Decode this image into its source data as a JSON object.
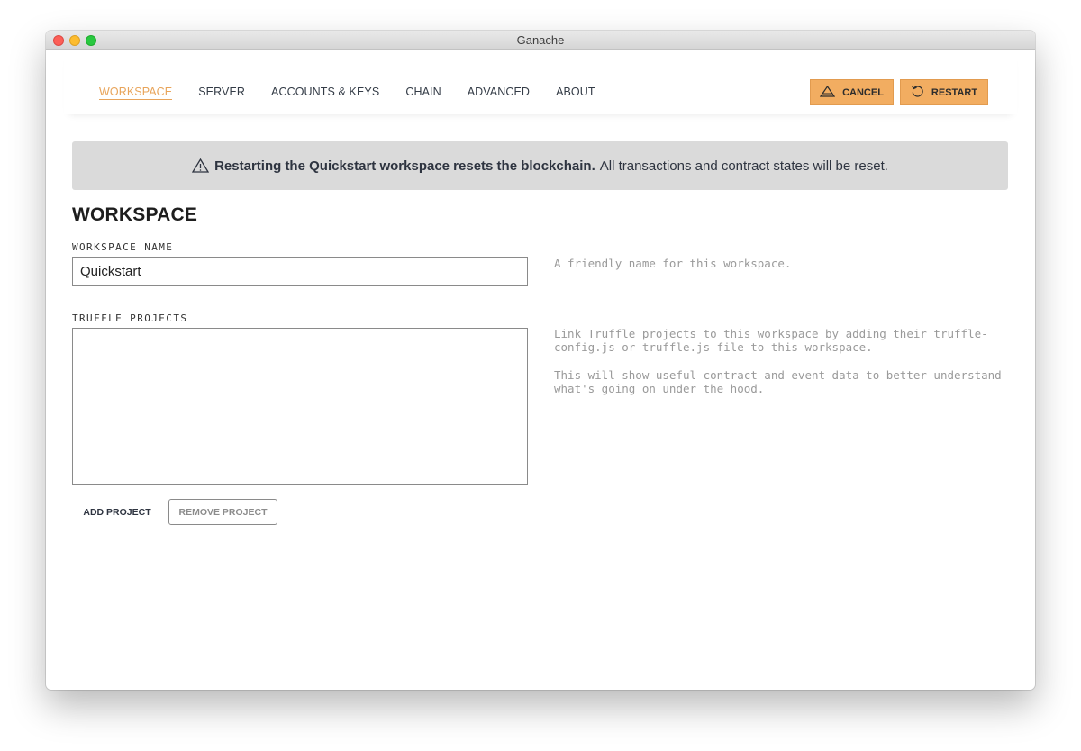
{
  "window": {
    "title": "Ganache"
  },
  "nav": {
    "items": [
      "WORKSPACE",
      "SERVER",
      "ACCOUNTS & KEYS",
      "CHAIN",
      "ADVANCED",
      "ABOUT"
    ],
    "active": "WORKSPACE"
  },
  "actions": {
    "cancel_label": "CANCEL",
    "restart_label": "RESTART"
  },
  "banner": {
    "bold": "Restarting the Quickstart workspace resets the blockchain.",
    "rest": "All transactions and contract states will be reset."
  },
  "section": {
    "title": "WORKSPACE",
    "workspace_name_label": "WORKSPACE NAME",
    "workspace_name_value": "Quickstart",
    "workspace_name_help": "A friendly name for this workspace.",
    "truffle_label": "TRUFFLE PROJECTS",
    "truffle_help_1": "Link Truffle projects to this workspace by adding their truffle-config.js or truffle.js file to this workspace.",
    "truffle_help_2": "This will show useful contract and event data to better understand what's going on under the hood.",
    "add_project_label": "ADD PROJECT",
    "remove_project_label": "REMOVE PROJECT"
  },
  "colors": {
    "accent": "#f2ad61",
    "active_nav": "#e8a45a",
    "banner_bg": "#dadada"
  },
  "icons": {
    "cancel": "warning-triangle-icon",
    "restart": "restart-arrow-icon",
    "banner": "warning-triangle-icon"
  }
}
